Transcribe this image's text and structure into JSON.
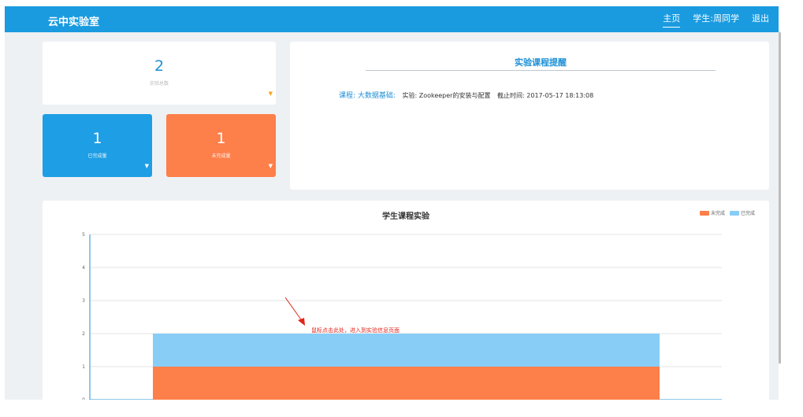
{
  "header": {
    "brand": "云中实验室",
    "nav": [
      {
        "label": "主页"
      },
      {
        "label": "学生:周同学"
      },
      {
        "label": "退出"
      }
    ]
  },
  "stats": {
    "total": {
      "value": "2",
      "label": "实验总数"
    },
    "done": {
      "value": "1",
      "label": "已完成量"
    },
    "undone": {
      "value": "1",
      "label": "未完成量"
    }
  },
  "reminder": {
    "title": "实验课程提醒",
    "course_label": "课程: 大数据基础:",
    "experiment": "实验: Zookeeper的安装与配置",
    "deadline": "截止时间: 2017-05-17 18:13:08"
  },
  "chart_data": {
    "type": "bar",
    "title": "学生课程实验",
    "ylim": [
      0,
      5
    ],
    "yticks": [
      "0",
      "1",
      "2",
      "3",
      "4",
      "5"
    ],
    "categories": [
      ""
    ],
    "stacked": true,
    "series": [
      {
        "name": "未完成",
        "values": [
          1
        ],
        "color": "#fd7f4a"
      },
      {
        "name": "已完成",
        "values": [
          1
        ],
        "color": "#88cdf6"
      }
    ],
    "legend_position": "top-right",
    "grid": true
  },
  "annotation": {
    "text": "鼠标点击此处，进入到实验信息页面",
    "color": "#e0251b"
  },
  "colors": {
    "header": "#1a9be0",
    "blue_card": "#1e9ee4",
    "orange_card": "#fd7f4a",
    "background": "#eef1f4"
  }
}
